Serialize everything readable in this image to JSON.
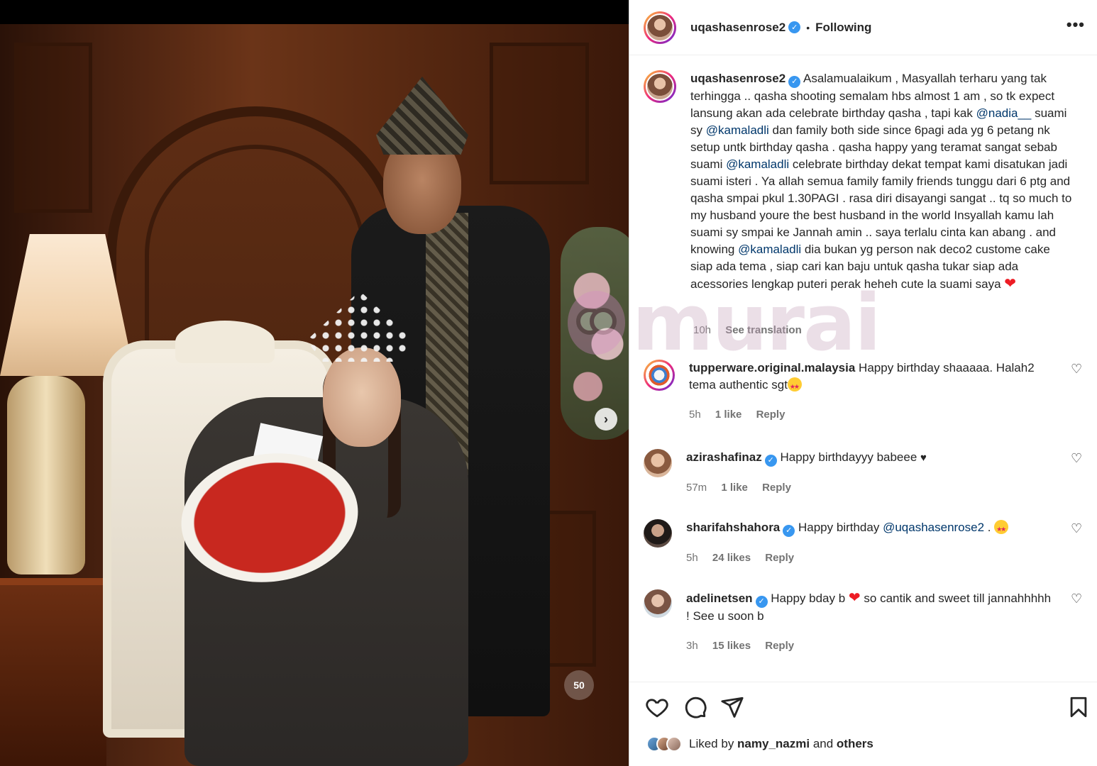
{
  "post": {
    "username": "uqashasenrose2",
    "follow_status": "Following",
    "separator": "•",
    "more_label": "•••"
  },
  "caption": {
    "username": "uqashasenrose2",
    "text_1": "Asalamualaikum , Masyallah terharu yang tak terhingga .. qasha shooting semalam hbs almost 1 am , so tk expect lansung akan ada celebrate birthday qasha , tapi kak ",
    "mention_1": "@nadia__",
    "text_2": " suami sy ",
    "mention_2": "@kamaladli",
    "text_3": " dan family both side since 6pagi ada yg 6 petang nk setup untk birthday qasha . qasha happy yang teramat sangat sebab suami ",
    "mention_3": "@kamaladli",
    "text_4": " celebrate birthday dekat tempat kami disatukan jadi suami isteri . Ya allah semua family family friends tunggu dari 6 ptg and qasha smpai pkul 1.30PAGI . rasa diri disayangi sangat .. tq so much to my husband youre the best husband in the world Insyallah kamu lah suami sy smpai ke Jannah amin .. saya terlalu cinta kan abang . and knowing ",
    "mention_4": "@kamaladli",
    "text_5": " dia bukan yg person nak deco2 custome cake siap ada tema , siap cari kan baju untuk qasha tukar siap ada acessories lengkap puteri perak heheh cute la suami saya ",
    "time": "10h",
    "translate": "See translation"
  },
  "comments": [
    {
      "username": "tupperware.original.malaysia",
      "text": "Happy birthday shaaaaa. Halah2 tema authentic sgt",
      "time": "5h",
      "likes": "1 like",
      "reply": "Reply"
    },
    {
      "username": "azirashafinaz",
      "text": "Happy birthdayyy babeee",
      "time": "57m",
      "likes": "1 like",
      "reply": "Reply"
    },
    {
      "username": "sharifahshahora",
      "text": "Happy birthday ",
      "mention": "@uqashasenrose2",
      "text_after": " . ",
      "time": "5h",
      "likes": "24 likes",
      "reply": "Reply"
    },
    {
      "username": "adelinetsen",
      "text": "Happy bday b ",
      "text_after": " so cantik and sweet till jannahhhhh ! See u soon b",
      "time": "3h",
      "likes": "15 likes",
      "reply": "Reply"
    }
  ],
  "likes": {
    "prefix": "Liked by ",
    "user": "namy_nazmi",
    "middle": " and ",
    "others": "others"
  },
  "watermark": {
    "text": "murai"
  },
  "photo": {
    "badge": "50"
  },
  "colors": {
    "accent_blue": "#3897f0",
    "mention_blue": "#00376b",
    "heart_red": "#ed1c24"
  },
  "icons": {
    "more": "more-horizontal-icon",
    "verified": "verified-badge-icon",
    "like": "heart-outline-icon",
    "comment": "comment-bubble-icon",
    "share": "paper-plane-icon",
    "save": "bookmark-icon",
    "next": "chevron-right-icon"
  }
}
